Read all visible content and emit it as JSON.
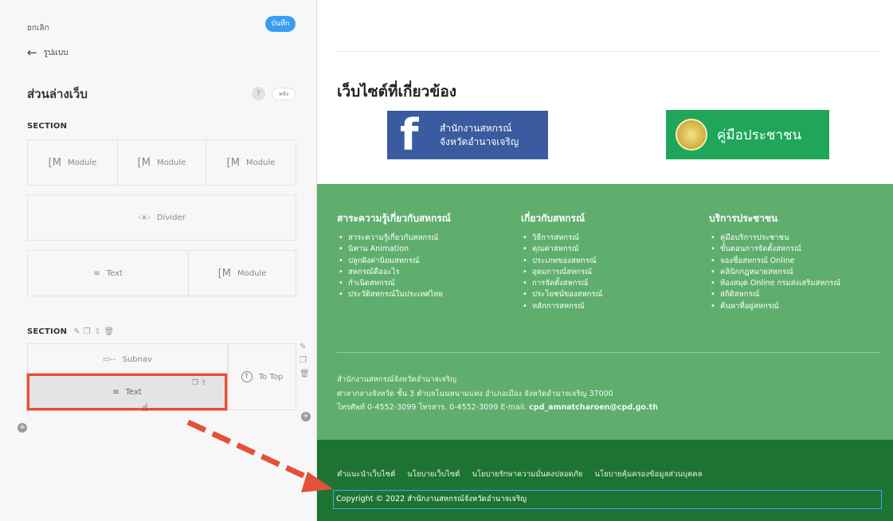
{
  "panel": {
    "cancel": "ยกเลิก",
    "save": "บันทึก",
    "back_arrow": "←",
    "back_label": "รูปแบบ",
    "title": "ส่วนล่างเว็บ",
    "help": "?",
    "back_link": "หลัง",
    "section1_label": "SECTION",
    "section2_label": "SECTION",
    "module_label": "Module",
    "divider_label": "Divider",
    "divider_icon": "-×-",
    "text_label": "Text",
    "text_icon": "≡",
    "subnav_label": "Subnav",
    "subnav_icon": "▭--",
    "totop_label": "To Top",
    "totop_icon": "↑",
    "module_icon": "[M"
  },
  "preview": {
    "related_title": "เว็บไซต์ที่เกี่ยวข้อง",
    "fb_banner_line1": "สำนักงานสหกรณ์",
    "fb_banner_line2": "จังหวัดอำนาจเจริญ",
    "fb_logo": "f",
    "manual_banner": "คู่มือประชาชน",
    "columns": [
      {
        "title": "สาระความรู้เกี่ยวกับสหกรณ์",
        "items": [
          "สาระความรู้เกี่ยวกับสหกรณ์",
          "นิทาน Animation",
          "ปลูกฝังค่านิยมสหกรณ์",
          "สหกรณ์คืออะไร",
          "กำเนิดสหกรณ์",
          "ประวัติสหกรณ์ในประเทศไทย"
        ]
      },
      {
        "title": "เกี่ยวกับสหกรณ์",
        "items": [
          "วิธีการสหกรณ์",
          "คุณค่าสหกรณ์",
          "ประเภทของสหกรณ์",
          "อุดมการณ์สหกรณ์",
          "การจัดตั้งสหกรณ์",
          "ประโยชน์ของสหกรณ์",
          "หลักการสหกรณ์"
        ]
      },
      {
        "title": "บริการประชาชน",
        "items": [
          "คู่มือบริการประชาชน",
          "ขั้นตอนการจัดตั้งสหกรณ์",
          "จองชื่อสหกรณ์ Online",
          "คลินิกกฎหมายสหกรณ์",
          "ห้องสมุด Online กรมส่งเสริมสหกรณ์",
          "สถิติสหกรณ์",
          "ค้นหาที่อยู่สหกรณ์"
        ]
      }
    ],
    "address_line1": "สำนักงานสหกรณ์จังหวัดอำนาจเจริญ",
    "address_line2": "ศาลากลางจังหวัด ชั้น 3 ตำบลโนนหนามแท่ง อำเภอเมือง จังหวัดอำนาจเจริญ 37000",
    "address_line3_prefix": "โทรศัพท์ 0-4552-3099 โทรสาร. 0-4552-3099 E-mail.",
    "email": "cpd_amnatcharoen@cpd.go.th",
    "footer_links": [
      "คำแนะนำเว็บไซต์",
      "นโยบายเว็บไซต์",
      "นโยบายรักษาความมั่นคงปลอดภัย",
      "นโยบายคุ้มครองข้อมูลส่วนบุคคล"
    ],
    "copyright": "Copyright © 2022 สำนักงานสหกรณ์จังหวัดอำนาจเจริญ"
  },
  "colors": {
    "accent_blue": "#3a9cf0",
    "selection_red": "#e5503a",
    "green_main": "#5fae6d",
    "green_footer": "#1d7432",
    "facebook_blue": "#3a5b9f",
    "manual_green": "#20a65a"
  }
}
